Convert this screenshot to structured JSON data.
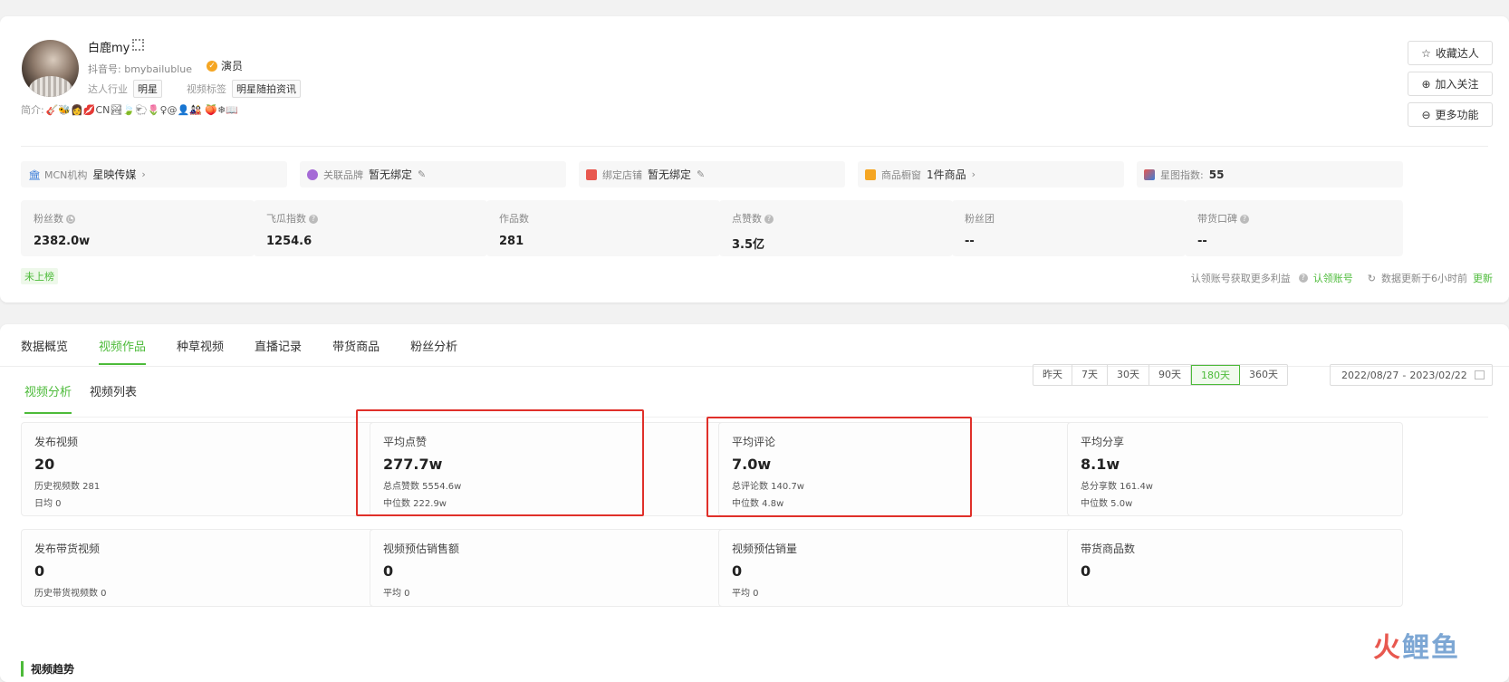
{
  "profile": {
    "name": "白鹿my",
    "douyin_label": "抖音号:",
    "douyin_id": "bmybailublue",
    "role": "演员",
    "industry_label": "达人行业",
    "industry": "明星",
    "video_tag_label": "视频标签",
    "video_tag": "明星随拍资讯",
    "intro_label": "简介:",
    "intro_emojis": "🎸🐝👩💋CN🏞🍃🐑🌷♀@👤🎎 🍑❄📖"
  },
  "actions": {
    "collect": "收藏达人",
    "follow": "加入关注",
    "more": "更多功能"
  },
  "info_bar": {
    "mcn_label": "MCN机构",
    "mcn_value": "星映传媒",
    "brand_label": "关联品牌",
    "brand_value": "暂无绑定",
    "shop_label": "绑定店铺",
    "shop_value": "暂无绑定",
    "window_label": "商品橱窗",
    "window_value": "1件商品",
    "star_label": "星图指数:",
    "star_value": "55"
  },
  "stats": [
    {
      "label": "粉丝数",
      "value": "2382.0w"
    },
    {
      "label": "飞瓜指数",
      "value": "1254.6"
    },
    {
      "label": "作品数",
      "value": "281"
    },
    {
      "label": "点赞数",
      "value": "3.5亿"
    },
    {
      "label": "粉丝团",
      "value": "--"
    },
    {
      "label": "带货口碑",
      "value": "--"
    }
  ],
  "footer": {
    "rank": "未上榜",
    "claim_text": "认领账号获取更多利益",
    "claim_link": "认领账号",
    "update_text": "数据更新于6小时前",
    "update_link": "更新"
  },
  "tabs": [
    "数据概览",
    "视频作品",
    "种草视频",
    "直播记录",
    "带货商品",
    "粉丝分析"
  ],
  "subtabs": [
    "视频分析",
    "视频列表"
  ],
  "ranges": [
    "昨天",
    "7天",
    "30天",
    "90天",
    "180天",
    "360天"
  ],
  "date_range": {
    "start": "2022/08/27",
    "sep": "-",
    "end": "2023/02/22"
  },
  "metrics_row1": [
    {
      "title": "发布视频",
      "value": "20",
      "sub1": "历史视频数 281",
      "sub2": "日均 0"
    },
    {
      "title": "平均点赞",
      "value": "277.7w",
      "sub1": "总点赞数 5554.6w",
      "sub2": "中位数 222.9w"
    },
    {
      "title": "平均评论",
      "value": "7.0w",
      "sub1": "总评论数 140.7w",
      "sub2": "中位数 4.8w"
    },
    {
      "title": "平均分享",
      "value": "8.1w",
      "sub1": "总分享数 161.4w",
      "sub2": "中位数 5.0w"
    }
  ],
  "metrics_row2": [
    {
      "title": "发布带货视频",
      "value": "0",
      "sub1": "历史带货视频数 0"
    },
    {
      "title": "视频预估销售额",
      "value": "0",
      "sub1": "平均 0"
    },
    {
      "title": "视频预估销量",
      "value": "0",
      "sub1": "平均 0"
    },
    {
      "title": "带货商品数",
      "value": "0",
      "sub1": ""
    }
  ],
  "trend_title": "视频趋势",
  "watermark": {
    "a": "火",
    "b": "鲤",
    "c": "鱼"
  },
  "colors": {
    "accent": "#4dbb3a",
    "highlight": "#e0302a"
  }
}
